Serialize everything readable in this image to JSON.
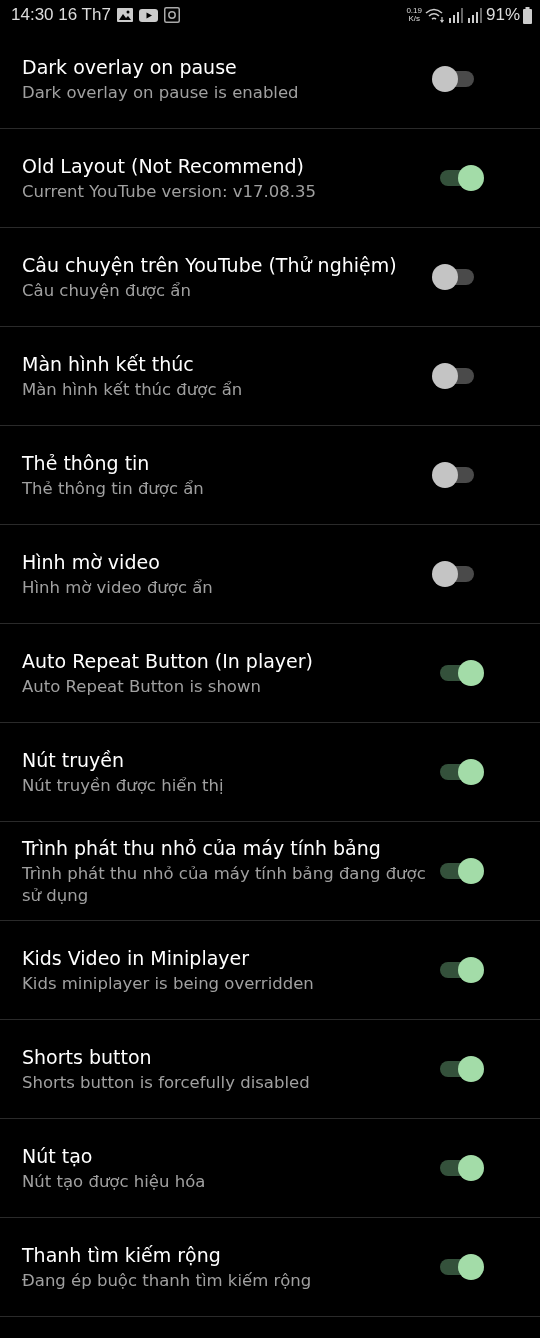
{
  "status_bar": {
    "time": "14:30 16 Th7",
    "net_speed": "0.19",
    "net_unit": "K/s",
    "battery": "91%"
  },
  "settings": [
    {
      "title": "Dark overlay on pause",
      "summary": "Dark overlay on pause is enabled",
      "on": false
    },
    {
      "title": "Old Layout (Not Recommend)",
      "summary": "Current YouTube version: v17.08.35",
      "on": true
    },
    {
      "title": "Câu chuyện trên YouTube (Thử nghiệm)",
      "summary": "Câu chuyện được ẩn",
      "on": false
    },
    {
      "title": "Màn hình kết thúc",
      "summary": "Màn hình kết thúc được ẩn",
      "on": false
    },
    {
      "title": "Thẻ thông tin",
      "summary": "Thẻ thông tin được ẩn",
      "on": false
    },
    {
      "title": "Hình mờ video",
      "summary": "Hình mờ video được ẩn",
      "on": false
    },
    {
      "title": "Auto Repeat Button (In player)",
      "summary": "Auto Repeat Button is shown",
      "on": true
    },
    {
      "title": "Nút truyền",
      "summary": "Nút truyền được hiển thị",
      "on": true
    },
    {
      "title": "Trình phát thu nhỏ của máy tính bảng",
      "summary": "Trình phát thu nhỏ của máy tính bảng đang được sử dụng",
      "on": true
    },
    {
      "title": "Kids Video in Miniplayer",
      "summary": "Kids miniplayer is being overridden",
      "on": true
    },
    {
      "title": "Shorts button",
      "summary": "Shorts button is forcefully disabled",
      "on": true
    },
    {
      "title": "Nút tạo",
      "summary": "Nút tạo được hiệu hóa",
      "on": true
    },
    {
      "title": "Thanh tìm kiếm rộng",
      "summary": "Đang ép buộc thanh tìm kiếm rộng",
      "on": true
    }
  ]
}
